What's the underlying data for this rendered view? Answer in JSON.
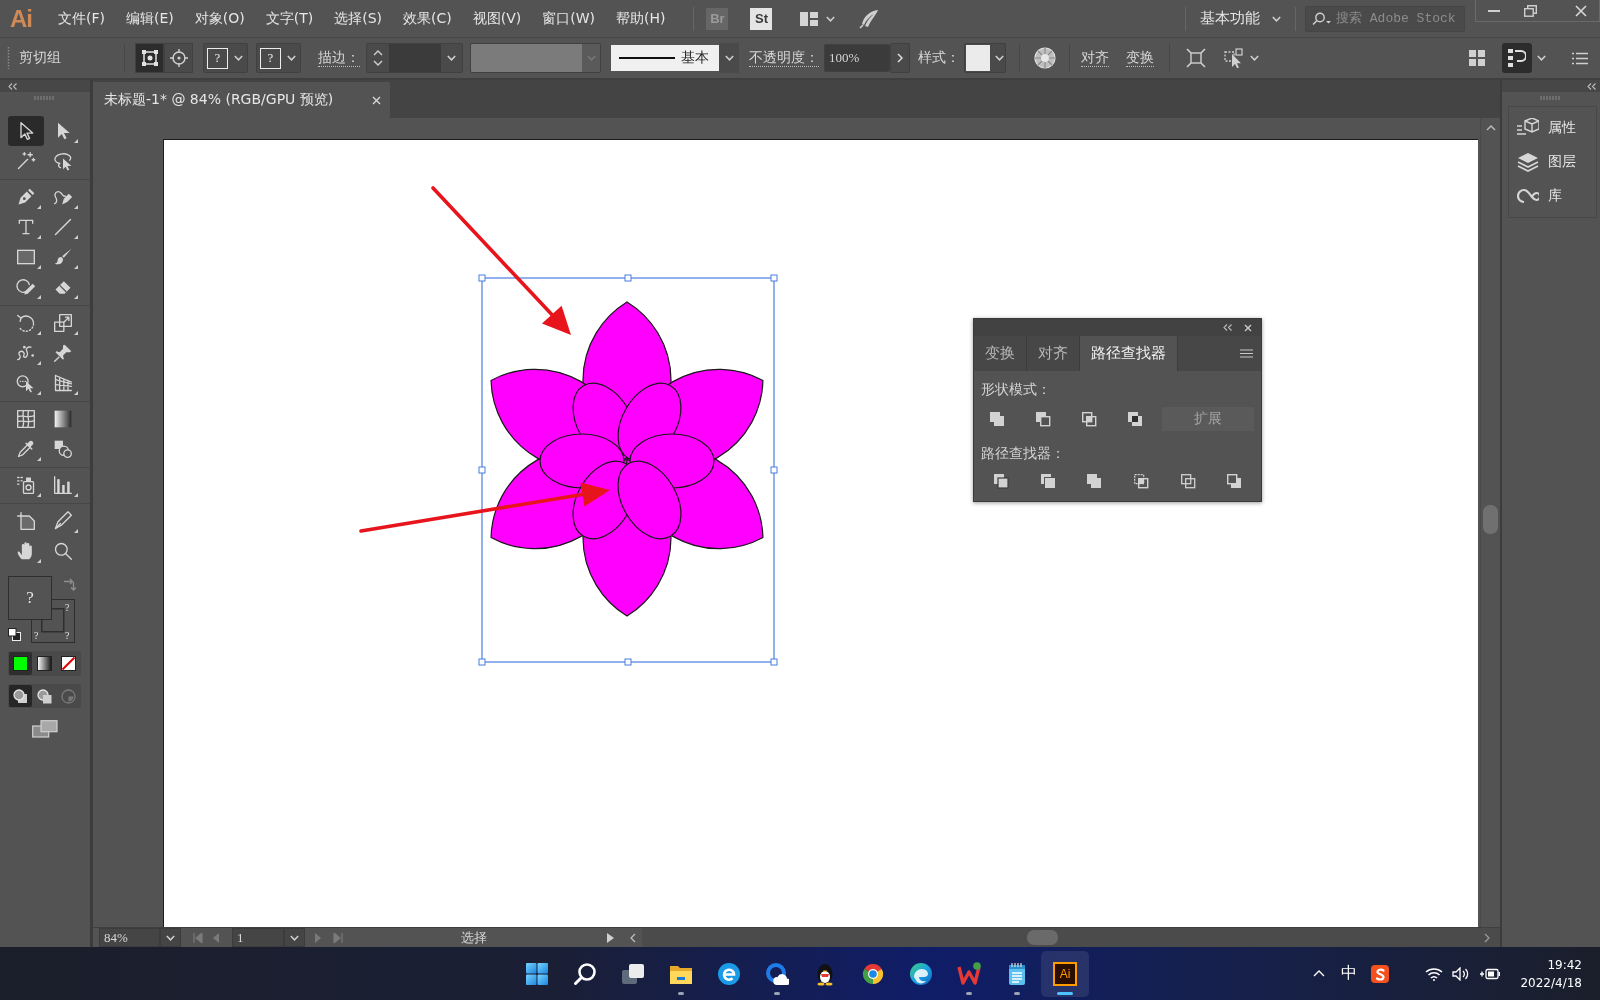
{
  "menu_bar": {
    "logo": "Ai",
    "items": [
      "文件(F)",
      "编辑(E)",
      "对象(O)",
      "文字(T)",
      "选择(S)",
      "效果(C)",
      "视图(V)",
      "窗口(W)",
      "帮助(H)"
    ],
    "apps": [
      {
        "label": "Br",
        "disabled": true
      },
      {
        "label": "St",
        "disabled": false
      }
    ],
    "workspace": "基本功能",
    "search": {
      "placeholder": "搜索 Adobe Stock"
    }
  },
  "control_bar": {
    "selection": "剪切组",
    "edit_modes": [
      {
        "kind": "path",
        "selected": true
      },
      {
        "kind": "contents",
        "selected": false
      }
    ],
    "fill": "?",
    "stroke": "?",
    "stroke_label": "描边：",
    "stroke_style": "基本",
    "opacity_label": "不透明度：",
    "opacity": "100%",
    "style_label": "样式：",
    "align": "对齐",
    "transform": "变换",
    "panel_toggles": [
      {
        "kind": "grid",
        "selected": false
      },
      {
        "kind": "properties",
        "selected": true
      }
    ]
  },
  "document_tab": {
    "title": "未标题-1* @ 84% (RGB/GPU 预览)"
  },
  "artwork": {
    "selected": true
  },
  "toolbar": {
    "tool_groups": [
      [
        {
          "kind": "select",
          "selected": true,
          "flyout": false
        },
        {
          "kind": "direct",
          "selected": false,
          "flyout": true
        },
        {
          "kind": "wand",
          "selected": false,
          "flyout": false
        },
        {
          "kind": "lasso",
          "selected": false,
          "flyout": false
        }
      ],
      [
        {
          "kind": "pen",
          "selected": false,
          "flyout": true
        },
        {
          "kind": "curvature",
          "selected": false,
          "flyout": true
        },
        {
          "kind": "type",
          "selected": false,
          "flyout": true
        },
        {
          "kind": "line",
          "selected": false,
          "flyout": true
        },
        {
          "kind": "rect",
          "selected": false,
          "flyout": true
        },
        {
          "kind": "brush",
          "selected": false,
          "flyout": true
        },
        {
          "kind": "shaper",
          "selected": false,
          "flyout": true
        },
        {
          "kind": "eraser",
          "selected": false,
          "flyout": true
        }
      ],
      [
        {
          "kind": "rotate",
          "selected": false,
          "flyout": true
        },
        {
          "kind": "scale",
          "selected": false,
          "flyout": true
        },
        {
          "kind": "warp",
          "selected": false,
          "flyout": true
        },
        {
          "kind": "pin",
          "selected": false,
          "flyout": false
        },
        {
          "kind": "freetransform",
          "selected": false,
          "flyout": true
        },
        {
          "kind": "perspective",
          "selected": false,
          "flyout": true
        }
      ],
      [
        {
          "kind": "mesh",
          "selected": false,
          "flyout": false
        },
        {
          "kind": "gradient",
          "selected": false,
          "flyout": false
        },
        {
          "kind": "eyedropper",
          "selected": false,
          "flyout": true
        },
        {
          "kind": "blend",
          "selected": false,
          "flyout": false
        }
      ],
      [
        {
          "kind": "sprayer",
          "selected": false,
          "flyout": true
        },
        {
          "kind": "graph",
          "selected": false,
          "flyout": true
        }
      ],
      [
        {
          "kind": "artboard",
          "selected": false,
          "flyout": false
        },
        {
          "kind": "slice",
          "selected": false,
          "flyout": true
        },
        {
          "kind": "hand",
          "selected": false,
          "flyout": true
        },
        {
          "kind": "zoom",
          "selected": false,
          "flyout": false
        }
      ]
    ],
    "fill": "?",
    "stroke_marks": [
      "?",
      "?",
      "?"
    ],
    "color_modes": [
      {
        "kind": "color",
        "selected": true,
        "color": "#00ff00"
      },
      {
        "kind": "gradient",
        "selected": false
      },
      {
        "kind": "none",
        "selected": false
      }
    ],
    "draw_modes": [
      {
        "kind": "normal",
        "selected": true,
        "disabled": false
      },
      {
        "kind": "behind",
        "selected": false,
        "disabled": false
      },
      {
        "kind": "inside",
        "selected": false,
        "disabled": true
      }
    ]
  },
  "pathfinder_panel": {
    "tabs": [
      {
        "label": "变换",
        "selected": false
      },
      {
        "label": "对齐",
        "selected": false
      },
      {
        "label": "路径查找器",
        "selected": true
      }
    ],
    "shape_modes_label": "形状模式：",
    "expand": {
      "label": "扩展",
      "disabled": true
    },
    "pathfinders_label": "路径查找器："
  },
  "dock": {
    "items": [
      {
        "kind": "properties",
        "label": "属性"
      },
      {
        "kind": "layers",
        "label": "图层"
      },
      {
        "kind": "libraries",
        "label": "库"
      }
    ]
  },
  "status_bar": {
    "zoom": "84%",
    "artboard": "1",
    "tool": "选择"
  },
  "taskbar": {
    "apps": [
      {
        "kind": "start",
        "running": false,
        "active": false
      },
      {
        "kind": "search",
        "running": false,
        "active": false
      },
      {
        "kind": "taskview",
        "running": false,
        "active": false
      },
      {
        "kind": "folder",
        "running": true,
        "active": false
      },
      {
        "kind": "ebrowser",
        "running": false,
        "active": false
      },
      {
        "kind": "cloud",
        "running": true,
        "active": false
      },
      {
        "kind": "penguin",
        "running": false,
        "active": false
      },
      {
        "kind": "wheel",
        "running": false,
        "active": false
      },
      {
        "kind": "wave",
        "running": false,
        "active": false
      },
      {
        "kind": "office",
        "running": true,
        "active": false
      },
      {
        "kind": "notepad",
        "running": true,
        "active": false
      },
      {
        "kind": "tile",
        "label": "Ai",
        "running": true,
        "active": true
      }
    ],
    "ime": "中",
    "time": "19:42",
    "date": "2022/4/18"
  }
}
